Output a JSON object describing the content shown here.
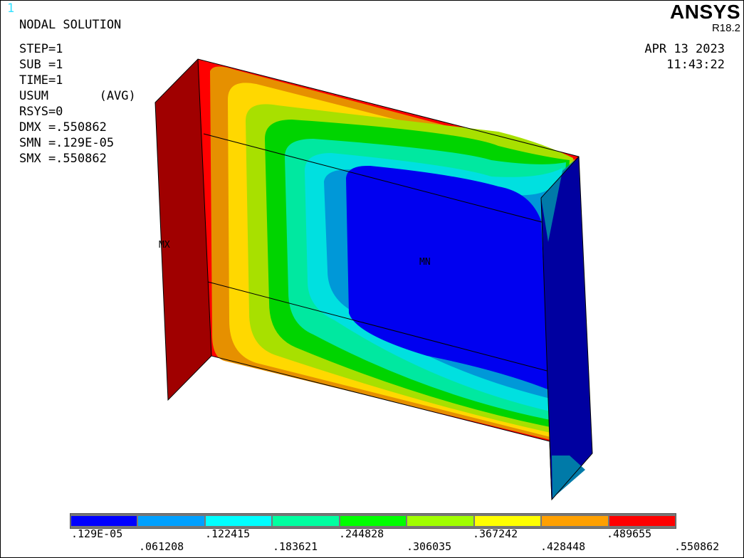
{
  "window_number": "1",
  "title": "NODAL SOLUTION",
  "info_lines": [
    "STEP=1",
    "SUB =1",
    "TIME=1",
    "USUM       (AVG)",
    "RSYS=0",
    "DMX =.550862",
    "SMN =.129E-05",
    "SMX =.550862"
  ],
  "brand": {
    "name": "ANSYS",
    "version": "R18.2"
  },
  "date": "APR 13 2023",
  "time": "11:43:22",
  "markers": {
    "max": "MX",
    "min": "MN"
  },
  "legend": {
    "colors": [
      "#0000ff",
      "#00a0ff",
      "#00ffff",
      "#00ffa0",
      "#00ff00",
      "#a0ff00",
      "#ffff00",
      "#ffa000",
      "#ff0000"
    ],
    "labels_top": [
      ".129E-05",
      ".122415",
      ".244828",
      ".367242",
      ".489655"
    ],
    "labels_bottom": [
      ".061208",
      ".183621",
      ".306035",
      ".428448",
      ".550862"
    ]
  },
  "model_colors": {
    "red": "#ff0000",
    "orange": "#e69000",
    "yellow": "#ffd800",
    "yellow_green": "#a8e000",
    "green": "#00d400",
    "aqua_green": "#00e8a0",
    "cyan": "#00e0e0",
    "light_blue": "#0098d8",
    "blue": "#0000f0",
    "dark_red": "#a00000",
    "dark_blue": "#0000a0",
    "teal": "#007aa8"
  }
}
